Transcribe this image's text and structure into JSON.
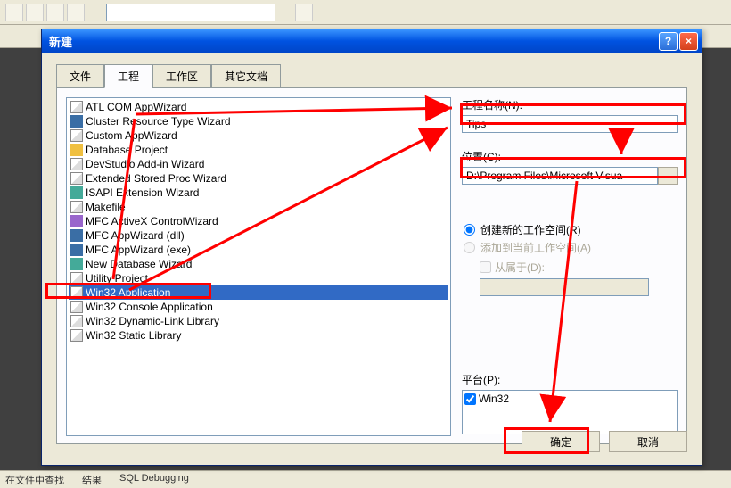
{
  "dialog": {
    "title": "新建",
    "help": "?",
    "close": "×"
  },
  "tabs": {
    "files": "文件",
    "projects": "工程",
    "workspaces": "工作区",
    "other": "其它文档"
  },
  "list": {
    "items": [
      "ATL COM AppWizard",
      "Cluster Resource Type Wizard",
      "Custom AppWizard",
      "Database Project",
      "DevStudio Add-in Wizard",
      "Extended Stored Proc Wizard",
      "ISAPI Extension Wizard",
      "Makefile",
      "MFC ActiveX ControlWizard",
      "MFC AppWizard (dll)",
      "MFC AppWizard (exe)",
      "New Database Wizard",
      "Utility Project",
      "Win32 Application",
      "Win32 Console Application",
      "Win32 Dynamic-Link Library",
      "Win32 Static Library"
    ],
    "selected_index": 13
  },
  "fields": {
    "project_name_label": "工程名称(N):",
    "project_name_value": "Tips",
    "location_label": "位置(C):",
    "location_value": "D:\\Program Files\\Microsoft Visua",
    "browse": "..."
  },
  "workspace": {
    "create_new": "创建新的工作空间(R)",
    "add_to_current": "添加到当前工作空间(A)",
    "dependency_of": "从属于(D):"
  },
  "platform": {
    "label": "平台(P):",
    "items": [
      "Win32"
    ]
  },
  "buttons": {
    "ok": "确定",
    "cancel": "取消"
  },
  "status": {
    "tab1": "在文件中查找",
    "tab2": "结果",
    "tab3": "SQL Debugging"
  }
}
